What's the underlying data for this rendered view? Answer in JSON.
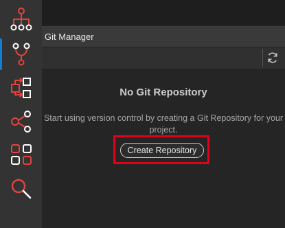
{
  "panel": {
    "title": "Git Manager"
  },
  "empty_state": {
    "title": "No Git Repository",
    "description": "Start using version control by creating a Git Repository for your project.",
    "button_label": "Create Repository"
  },
  "activity_bar": {
    "items": [
      "hierarchy-icon",
      "git-branch-icon",
      "workflow-icon",
      "share-icon",
      "grid-icon",
      "search-icon"
    ],
    "active": "git-branch-icon"
  },
  "colors": {
    "icon_red": "#e0443e",
    "icon_white": "#ffffff",
    "accent_blue": "#0e7fd2",
    "highlight_red": "#e3001b"
  }
}
